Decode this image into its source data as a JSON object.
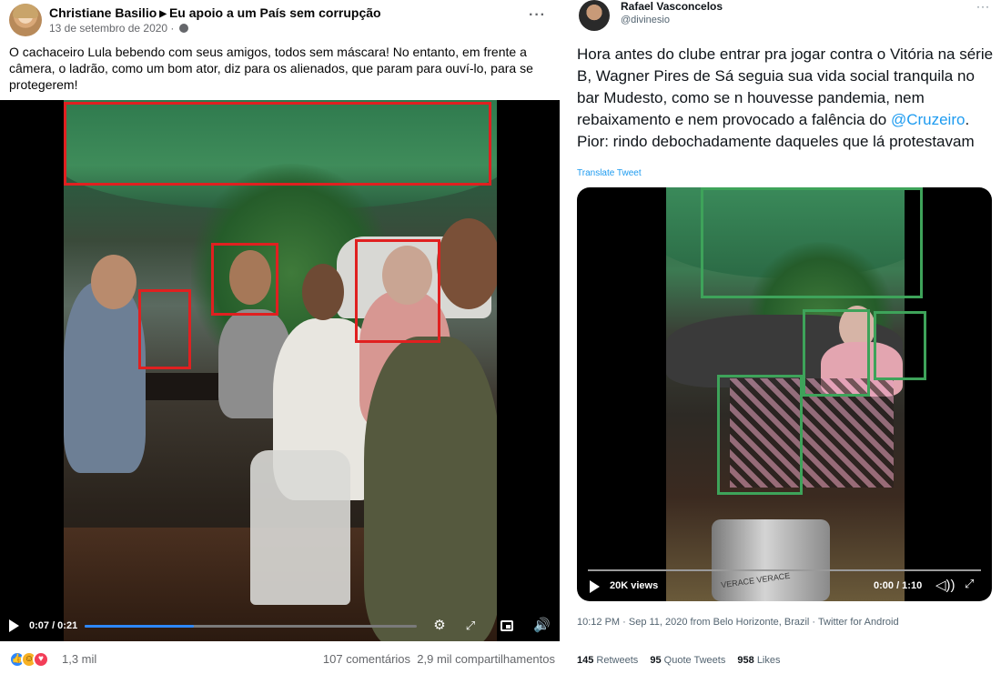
{
  "facebook": {
    "author": "Christiane Basilio",
    "group": "Eu apoio a um País sem corrupção",
    "date": "13 de setembro de 2020 ·",
    "more": "···",
    "text": "O cachaceiro Lula bebendo com seus amigos, todos sem máscara! No entanto, em frente a câmera, o ladrão, como um bom ator, diz para os alienados, que param para ouví-lo, para se protegerem!",
    "video": {
      "time": "0:07 / 0:21",
      "progress_fraction": 0.33
    },
    "reactions_count": "1,3 mil",
    "comments": "107 comentários",
    "shares": "2,9 mil compartilhamentos",
    "reaction_icons": [
      "like-icon",
      "haha-icon",
      "love-icon"
    ]
  },
  "tweet": {
    "author": "Rafael Vasconcelos",
    "handle": "@divinesio",
    "more": "···",
    "text_before": "Hora antes do clube entrar pra jogar contra o Vitória na série B, Wagner Pires de Sá seguia sua vida social tranquila no bar Mudesto, como se n houvesse pandemia, nem rebaixamento e nem provocado a falência do ",
    "mention": "@Cruzeiro",
    "text_after": ". Pior: rindo debochadamente daqueles que lá protestavam",
    "translate": "Translate Tweet",
    "video": {
      "views": "20K views",
      "time": "0:00 / 1:10",
      "keg_label": "VERACE  VERACE"
    },
    "meta": "10:12 PM · Sep 11, 2020 from Belo Horizonte, Brazil · Twitter for Android",
    "stats": {
      "retweets_num": "145",
      "retweets_label": "Retweets",
      "quotes_num": "95",
      "quotes_label": "Quote Tweets",
      "likes_num": "958",
      "likes_label": "Likes"
    }
  },
  "colors": {
    "highlight_red": "#e02020",
    "highlight_green": "#3ea35a",
    "fb_blue": "#2d88ff",
    "twitter_blue": "#1d9bf0"
  }
}
